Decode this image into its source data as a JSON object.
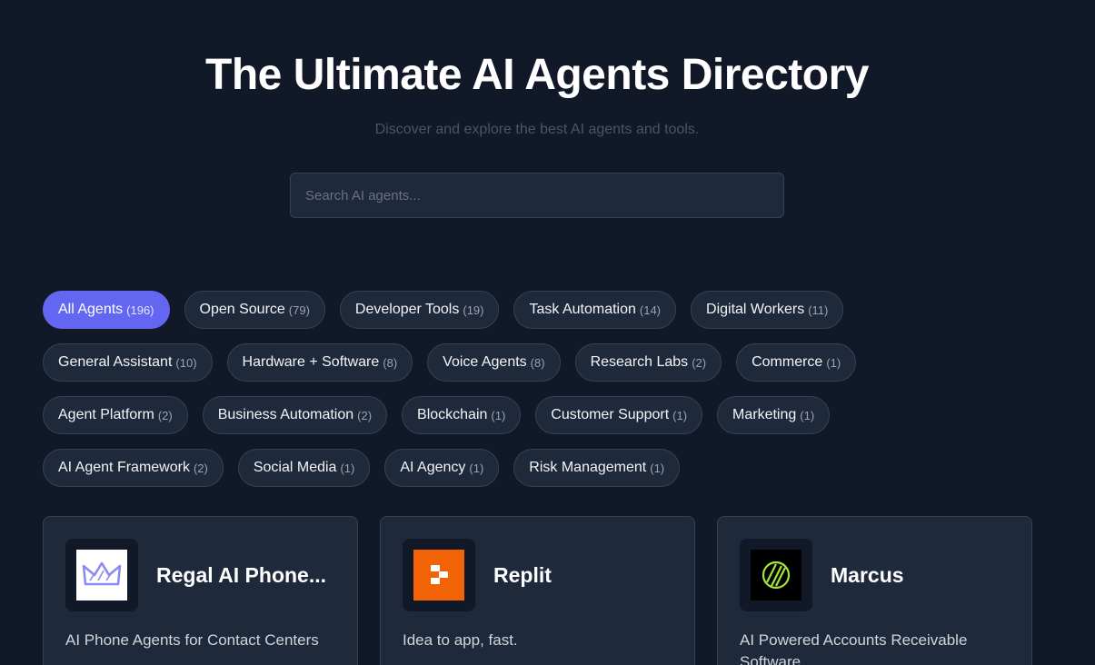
{
  "header": {
    "title": "The Ultimate AI Agents Directory",
    "subtitle": "Discover and explore the best AI agents and tools."
  },
  "search": {
    "placeholder": "Search AI agents...",
    "value": ""
  },
  "categories": [
    {
      "label": "All Agents",
      "count": "(196)",
      "active": true
    },
    {
      "label": "Open Source",
      "count": "(79)"
    },
    {
      "label": "Developer Tools",
      "count": "(19)"
    },
    {
      "label": "Task Automation",
      "count": "(14)"
    },
    {
      "label": "Digital Workers",
      "count": "(11)"
    },
    {
      "label": "General Assistant",
      "count": "(10)"
    },
    {
      "label": "Hardware + Software",
      "count": "(8)"
    },
    {
      "label": "Voice Agents",
      "count": "(8)"
    },
    {
      "label": "Research Labs",
      "count": "(2)"
    },
    {
      "label": "Commerce",
      "count": "(1)"
    },
    {
      "label": "Agent Platform",
      "count": "(2)"
    },
    {
      "label": "Business Automation",
      "count": "(2)"
    },
    {
      "label": "Blockchain",
      "count": "(1)"
    },
    {
      "label": "Customer Support",
      "count": "(1)"
    },
    {
      "label": "Marketing",
      "count": "(1)"
    },
    {
      "label": "AI Agent Framework",
      "count": "(2)"
    },
    {
      "label": "Social Media",
      "count": "(1)"
    },
    {
      "label": "AI Agency",
      "count": "(1)"
    },
    {
      "label": "Risk Management",
      "count": "(1)"
    }
  ],
  "agents": [
    {
      "name": "Regal AI Phone...",
      "description": "AI Phone Agents for Contact Centers",
      "logo_icon": "crown-icon",
      "logo_color": "#8b8cf0"
    },
    {
      "name": "Replit",
      "description": "Idea to app, fast.",
      "logo_icon": "replit-logo-icon",
      "logo_color": "#f26207"
    },
    {
      "name": "Marcus",
      "description": "AI Powered Accounts Receivable Software",
      "logo_icon": "marcus-logo-icon",
      "logo_color": "#a3e635"
    }
  ],
  "colors": {
    "background": "#111827",
    "surface": "#1e293b",
    "accent": "#6366f1"
  }
}
